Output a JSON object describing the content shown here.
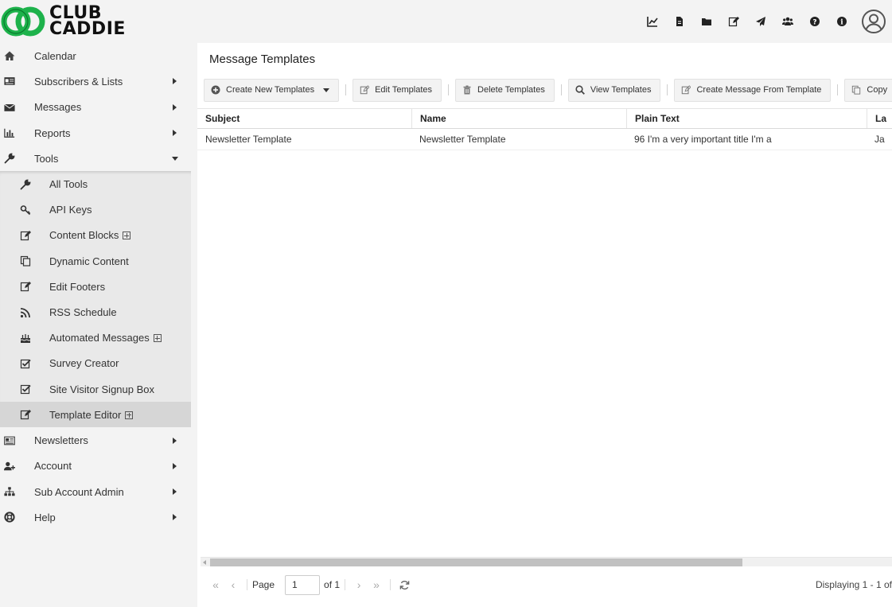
{
  "brand": {
    "line1": "CLUB",
    "line2": "CADDIE",
    "color": "#1db24b"
  },
  "topbar": {
    "icons": [
      "chart-line-icon",
      "file-icon",
      "folder-icon",
      "edit-icon",
      "paper-plane-icon",
      "users-icon",
      "question-icon",
      "info-icon",
      "user-avatar-icon"
    ]
  },
  "sidebar": {
    "items": [
      {
        "label": "Calendar",
        "icon": "home-icon",
        "caret": false
      },
      {
        "label": "Subscribers & Lists",
        "icon": "address-card-icon",
        "caret": "right"
      },
      {
        "label": "Messages",
        "icon": "envelope-icon",
        "caret": "right"
      },
      {
        "label": "Reports",
        "icon": "bar-chart-icon",
        "caret": "right"
      },
      {
        "label": "Tools",
        "icon": "wrench-icon",
        "caret": "down"
      }
    ],
    "tools_submenu": [
      {
        "label": "All Tools",
        "icon": "wrench-icon"
      },
      {
        "label": "API Keys",
        "icon": "key-icon"
      },
      {
        "label": "Content Blocks",
        "icon": "edit-icon",
        "expandable": true
      },
      {
        "label": "Dynamic Content",
        "icon": "copy-icon"
      },
      {
        "label": "Edit Footers",
        "icon": "edit-icon"
      },
      {
        "label": "RSS Schedule",
        "icon": "rss-icon"
      },
      {
        "label": "Automated Messages",
        "icon": "birthday-cake-icon",
        "expandable": true
      },
      {
        "label": "Survey Creator",
        "icon": "check-square-icon"
      },
      {
        "label": "Site Visitor Signup Box",
        "icon": "check-square-icon"
      },
      {
        "label": "Template Editor",
        "icon": "edit-icon",
        "expandable": true,
        "active": true
      }
    ],
    "items_after": [
      {
        "label": "Newsletters",
        "icon": "newspaper-icon",
        "caret": "right"
      },
      {
        "label": "Account",
        "icon": "user-plus-icon",
        "caret": "right"
      },
      {
        "label": "Sub Account Admin",
        "icon": "sitemap-icon",
        "caret": "right"
      },
      {
        "label": "Help",
        "icon": "life-ring-icon",
        "caret": "right"
      }
    ]
  },
  "panel": {
    "title": "Message Templates",
    "toolbar": {
      "create_new": "Create New Templates",
      "edit": "Edit Templates",
      "delete": "Delete Templates",
      "view": "View Templates",
      "create_message": "Create Message From Template",
      "copy": "Copy"
    },
    "grid": {
      "columns": [
        "Subject",
        "Name",
        "Plain Text",
        "La"
      ],
      "rows": [
        [
          "Newsletter Template",
          "Newsletter Template",
          "96 I'm a very important title I'm a",
          "Ja"
        ]
      ]
    },
    "pager": {
      "page_label": "Page",
      "page_value": "1",
      "of_label": "of 1",
      "display_info": "Displaying 1 - 1 of"
    }
  }
}
